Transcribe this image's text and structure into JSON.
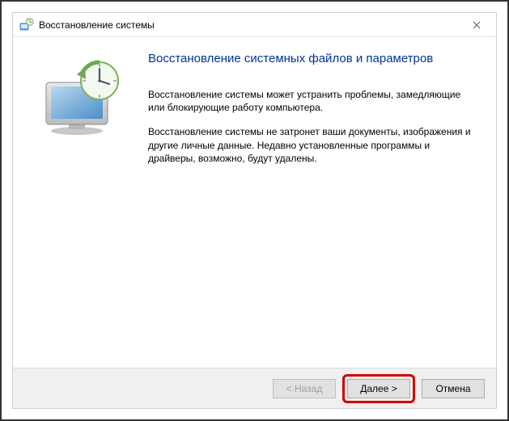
{
  "window": {
    "title": "Восстановление системы"
  },
  "main": {
    "heading": "Восстановление системных файлов и параметров",
    "para1": "Восстановление системы может устранить проблемы, замедляющие или блокирующие работу компьютера.",
    "para2": "Восстановление системы не затронет ваши документы, изображения и другие личные данные. Недавно установленные программы и драйверы, возможно, будут удалены."
  },
  "footer": {
    "back_label": "< Назад",
    "next_label": "Далее >",
    "cancel_label": "Отмена"
  }
}
